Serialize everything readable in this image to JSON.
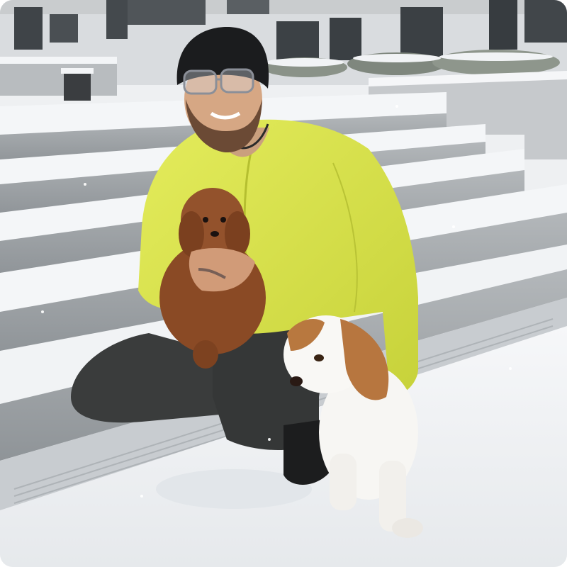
{
  "photo": {
    "subject": "person-with-two-dogs",
    "setting": "snowy-outdoor-steps",
    "palette": {
      "snow": "#f3f5f7",
      "concrete": "#a7acb0",
      "jacket": "#d8e24a",
      "beanie": "#1b1c1e",
      "trousers": "#3a3c3c",
      "puppy": "#8a4a25",
      "spaniel-white": "#f7f6f3",
      "spaniel-tan": "#b7763f"
    }
  }
}
